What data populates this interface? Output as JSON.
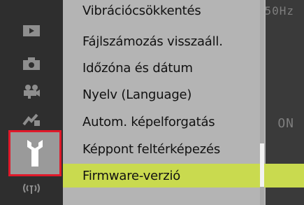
{
  "menu": {
    "items": [
      {
        "label": "Vibrációcsökkentés",
        "value": "50Hz"
      },
      {
        "label": "Fájlszámozás visszaáll.",
        "value": ""
      },
      {
        "label": "Időzóna és dátum",
        "value": ""
      },
      {
        "label": "Nyelv (Language)",
        "value": ""
      },
      {
        "label": "Autom. képelforgatás",
        "value": "ON"
      },
      {
        "label": "Képpont feltérképezés",
        "value": ""
      },
      {
        "label": "Firmware-verzió",
        "value": ""
      }
    ],
    "selected_index": 6
  },
  "tabs": [
    {
      "icon": "playback-icon"
    },
    {
      "icon": "camera-icon"
    },
    {
      "icon": "movie-icon"
    },
    {
      "icon": "custom-settings-icon"
    },
    {
      "icon": "wrench-icon",
      "active": true
    },
    {
      "icon": "wireless-icon"
    }
  ],
  "colors": {
    "highlight": "#c9da4f",
    "active_tab_border": "#e0192a",
    "menu_bg": "#b4b4b4",
    "sidebar_bg": "#2e2e2e"
  }
}
